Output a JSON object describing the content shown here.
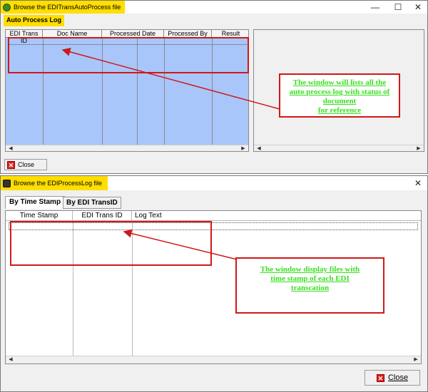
{
  "win1": {
    "title": "Browse the EDITransAutoProcess file",
    "tab": "Auto Process Log",
    "columns": [
      "EDI Trans ID",
      "Doc Name",
      "Processed Date",
      "Processed By",
      "Result"
    ],
    "close_label": "Close",
    "callout": [
      "The window will lists all the",
      "auto process log with status of",
      "document",
      "for reference"
    ]
  },
  "win2": {
    "title": "Browse the EDIProcessLog file",
    "tabs": [
      "By Time Stamp",
      "By EDI TransID"
    ],
    "columns": [
      "Time Stamp",
      "EDI Trans ID",
      "Log Text"
    ],
    "close_label": "Close",
    "callout": [
      "The window display files with",
      "time stamp of each EDI",
      "transcation"
    ]
  },
  "colors": {
    "accent": "#ffde00",
    "grid_fill": "#a9c6fb",
    "annotation": "#d01818",
    "callout_text": "#39e020"
  }
}
